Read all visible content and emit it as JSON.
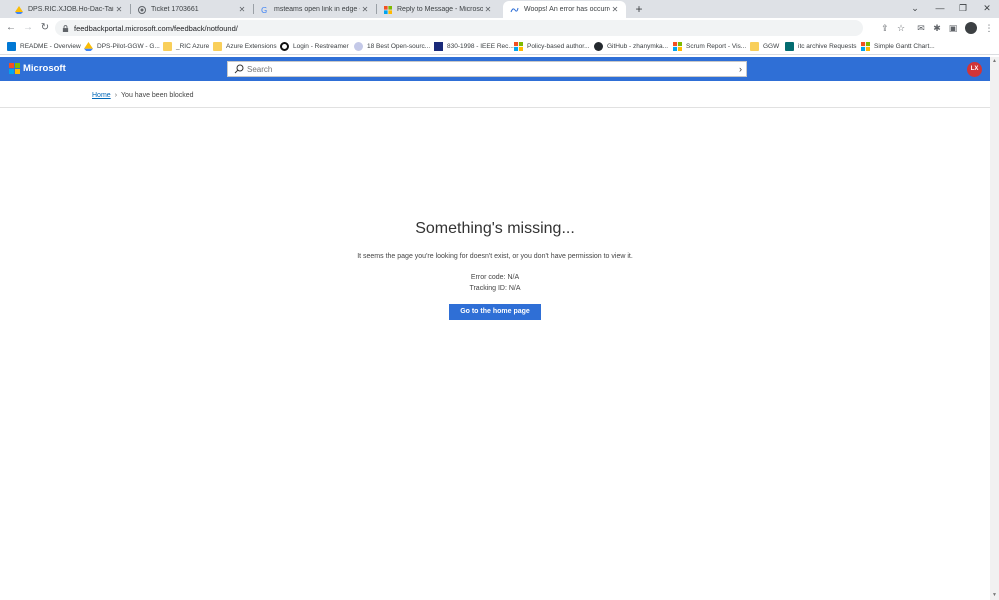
{
  "browser": {
    "tabs": [
      {
        "label": "DPS.RIC.XJOB.Ho-Dac-Tai - Google",
        "icon": "google-drive-icon"
      },
      {
        "label": "Ticket 1703661",
        "icon": "globe-icon"
      },
      {
        "label": "msteams open link in edge - Goo",
        "icon": "google-icon"
      },
      {
        "label": "Reply to Message - Microsoft Co",
        "icon": "microsoft-icon"
      },
      {
        "label": "Woops! An error has occurred - F",
        "icon": "feedback-icon",
        "active": true
      }
    ],
    "new_tab": "+",
    "address": "feedbackportal.microsoft.com/feedback/notfound/",
    "bookmarks": [
      {
        "label": "README - Overview",
        "icon": "azure-devops-icon"
      },
      {
        "label": "DPS-Pilot-GGW - G...",
        "icon": "google-drive-icon"
      },
      {
        "label": "_RIC Azure",
        "icon": "folder-icon"
      },
      {
        "label": "Azure Extensions",
        "icon": "folder-icon"
      },
      {
        "label": "Login - Restreamer",
        "icon": "restreamer-icon"
      },
      {
        "label": "18 Best Open-sourc...",
        "icon": "globe-icon"
      },
      {
        "label": "830-1998 - IEEE Rec...",
        "icon": "ieee-icon"
      },
      {
        "label": "Policy-based author...",
        "icon": "microsoft-icon"
      },
      {
        "label": "GitHub - zhanymka...",
        "icon": "github-icon"
      },
      {
        "label": "Scrum Report - Vis...",
        "icon": "microsoft-icon"
      },
      {
        "label": "GGW",
        "icon": "folder-icon"
      },
      {
        "label": "itc archive Requests",
        "icon": "sharepoint-icon"
      },
      {
        "label": "Simple Gantt Chart...",
        "icon": "microsoft-icon"
      }
    ]
  },
  "header": {
    "brand": "Microsoft",
    "search_placeholder": "Search",
    "avatar_initials": "LX"
  },
  "breadcrumb": {
    "home": "Home",
    "current": "You have been blocked"
  },
  "error": {
    "title": "Something's missing...",
    "message": "It seems the page you're looking for doesn't exist, or you don't have permission to view it.",
    "error_code": "Error code: N/A",
    "tracking_id": "Tracking ID: N/A",
    "home_button": "Go to the home page"
  }
}
